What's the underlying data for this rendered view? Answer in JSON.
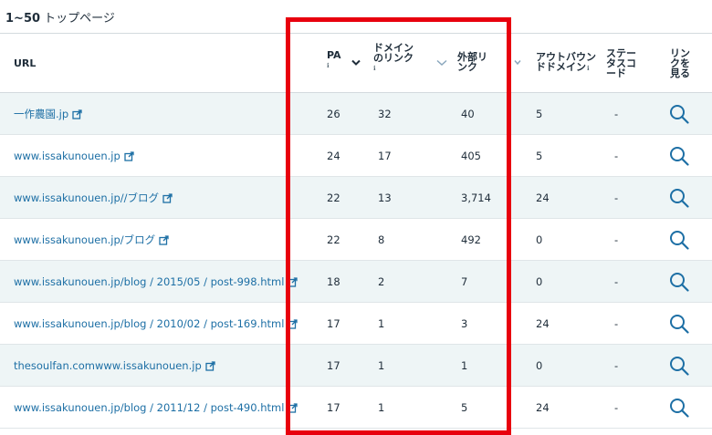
{
  "range_label": {
    "count": "1~50",
    "text": " トップページ"
  },
  "columns": {
    "url": "URL",
    "pa": "PA",
    "domain_links": [
      "ドメイン",
      "のリンク"
    ],
    "external_links": [
      "外部リ",
      "ンク"
    ],
    "outbound_domains": [
      "アウトバウン",
      "ドドメイン"
    ],
    "status_code": [
      "ステー",
      "タスコ",
      "ード"
    ],
    "view_links": [
      "リン",
      "クを",
      "見る"
    ]
  },
  "rows": [
    {
      "url": "一作農園.jp",
      "pa": "26",
      "domain_links": "32",
      "external_links": "40",
      "outbound": "5",
      "status": "-"
    },
    {
      "url": "www.issakunouen.jp",
      "pa": "24",
      "domain_links": "17",
      "external_links": "405",
      "outbound": "5",
      "status": "-"
    },
    {
      "url": "www.issakunouen.jp//ブログ",
      "pa": "22",
      "domain_links": "13",
      "external_links": "3,714",
      "outbound": "24",
      "status": "-"
    },
    {
      "url": "www.issakunouen.jp/ブログ",
      "pa": "22",
      "domain_links": "8",
      "external_links": "492",
      "outbound": "0",
      "status": "-"
    },
    {
      "url": "www.issakunouen.jp/blog / 2015/05 / post-998.html",
      "pa": "18",
      "domain_links": "2",
      "external_links": "7",
      "outbound": "0",
      "status": "-"
    },
    {
      "url": "www.issakunouen.jp/blog / 2010/02 / post-169.html",
      "pa": "17",
      "domain_links": "1",
      "external_links": "3",
      "outbound": "24",
      "status": "-"
    },
    {
      "url": "thesoulfan.comwww.issakunouen.jp",
      "pa": "17",
      "domain_links": "1",
      "external_links": "1",
      "outbound": "0",
      "status": "-"
    },
    {
      "url": "www.issakunouen.jp/blog / 2011/12 / post-490.html",
      "pa": "17",
      "domain_links": "1",
      "external_links": "5",
      "outbound": "24",
      "status": "-"
    }
  ],
  "info_glyph": "ℹ",
  "icons": {
    "external": "external-link-icon",
    "search": "magnifier-icon",
    "sort": "chevron-down-icon"
  },
  "colors": {
    "link": "#1d6fa5",
    "highlight": "#e8000e",
    "stripe": "#eef5f6"
  }
}
